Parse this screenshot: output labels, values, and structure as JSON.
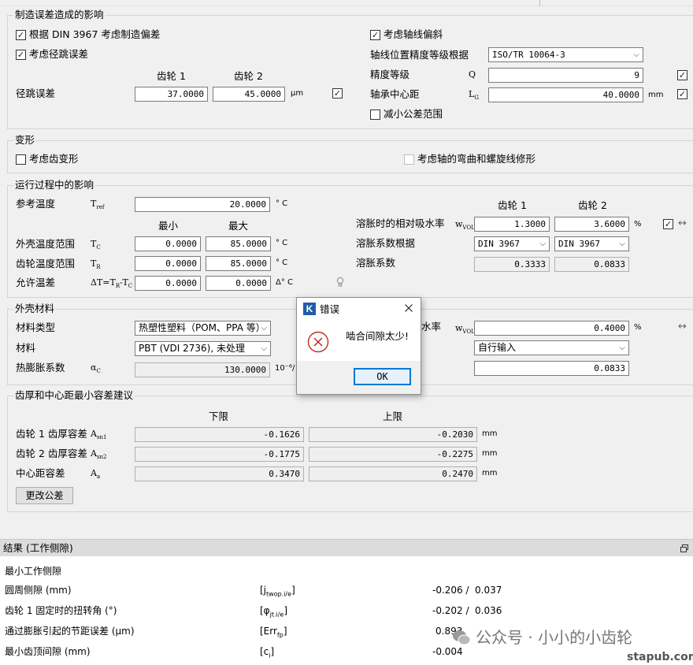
{
  "manufacturing": {
    "title": "制造误差造成的影响",
    "din3967_label": "根据 DIN 3967 考虑制造偏差",
    "runout_label": "考虑径跳误差",
    "gear1": "齿轮 1",
    "gear2": "齿轮 2",
    "runout_error_label": "径跳误差",
    "runout_g1": "37.0000",
    "runout_g2": "45.0000",
    "runout_unit": "μm",
    "axis_deviation_label": "考虑轴线偏斜",
    "axis_accuracy_label": "轴线位置精度等级根据",
    "axis_accuracy_value": "ISO/TR 10064-3",
    "accuracy_grade_label": "精度等级",
    "accuracy_grade_sym": "Q",
    "accuracy_grade_value": "9",
    "bearing_dist_label": "轴承中心距",
    "bearing_dist_sym": "L",
    "bearing_dist_sub": "G",
    "bearing_dist_value": "40.0000",
    "bearing_dist_unit": "mm",
    "reduce_tol_label": "减小公差范围"
  },
  "deformation": {
    "title": "变形",
    "tooth_label": "考虑齿变形",
    "shaft_label": "考虑轴的弯曲和螺旋线修形"
  },
  "operation": {
    "title": "运行过程中的影响",
    "ref_temp_label": "参考温度",
    "ref_temp_sym": "T",
    "ref_temp_sub": "ref",
    "ref_temp_value": "20.0000",
    "temp_unit": "° C",
    "min_label": "最小",
    "max_label": "最大",
    "housing_temp_label": "外壳温度范围",
    "housing_sym": "T",
    "housing_sub": "C",
    "housing_min": "0.0000",
    "housing_max": "85.0000",
    "gear_temp_label": "齿轮温度范围",
    "gear_sym": "T",
    "gear_sub": "R",
    "gear_min": "0.0000",
    "gear_max": "85.0000",
    "allow_diff_label": "允许温差",
    "allow_diff_sym": "ΔT=T",
    "allow_diff_sym_sub1": "R",
    "allow_diff_sym_mid": "-T",
    "allow_diff_sym_sub2": "C",
    "allow_min": "0.0000",
    "allow_max": "0.0000",
    "allow_unit": "Δ° C",
    "gear1": "齿轮 1",
    "gear2": "齿轮 2",
    "swelling_abs_label": "溶胀时的相对吸水率",
    "swelling_abs_sym": "w",
    "swelling_abs_sub": "VOL",
    "swelling_abs_g1": "1.3000",
    "swelling_abs_g2": "3.6000",
    "percent": "%",
    "swelling_coef_basis_label": "溶胀系数根据",
    "swelling_coef_basis_g1": "DIN 3967",
    "swelling_coef_basis_g2": "DIN 3967",
    "swelling_coef_label": "溶胀系数",
    "swelling_coef_g1": "0.3333",
    "swelling_coef_g2": "0.0833"
  },
  "housing": {
    "title": "外壳材料",
    "material_type_label": "材料类型",
    "material_type_value": "热塑性塑料（POM、PPA 等）",
    "material_label": "材料",
    "material_value": "PBT (VDI 2736), 未处理",
    "expansion_label": "热膨胀系数",
    "expansion_sym": "α",
    "expansion_sub": "C",
    "expansion_value": "130.0000",
    "expansion_unit": "10⁻⁶/",
    "abs_label_partial": "水率",
    "abs_sym": "w",
    "abs_sub": "VOL",
    "abs_value": "0.4000",
    "percent": "%",
    "input_mode_value": "自行输入",
    "coef_value": "0.0833"
  },
  "tolerance": {
    "title": "齿厚和中心距最小容差建议",
    "lower_label": "下限",
    "upper_label": "上限",
    "g1_label": "齿轮 1 齿厚容差",
    "g1_sym": "A",
    "g1_sub": "sn1",
    "g1_lower": "-0.1626",
    "g1_upper": "-0.2030",
    "g2_label": "齿轮 2 齿厚容差",
    "g2_sym": "A",
    "g2_sub": "sn2",
    "g2_lower": "-0.1775",
    "g2_upper": "-0.2275",
    "center_label": "中心距容差",
    "center_sym": "A",
    "center_sub": "a",
    "center_lower": "0.3470",
    "center_upper": "0.2470",
    "unit": "mm",
    "change_button": "更改公差"
  },
  "dialog": {
    "title": "错误",
    "app_icon_letter": "K",
    "message": "啮合间隙太少!",
    "ok_label": "OK"
  },
  "results": {
    "title": "结果 (工作侧隙)",
    "heading": "最小工作侧隙",
    "rows": [
      {
        "label": "圆周侧隙 (mm)",
        "sym": "[j",
        "sub": "twop.i/e",
        "close": "]",
        "v1": "-0.206 /",
        "v2": "0.037"
      },
      {
        "label": "齿轮 1 固定时的扭转角 (°)",
        "sym": "[φ",
        "sub": "jt.i/e",
        "close": "]",
        "v1": "-0.202 /",
        "v2": "0.036"
      },
      {
        "label": "通过膨胀引起的节距误差 (μm)",
        "sym": "[Err",
        "sub": "fp",
        "close": "]",
        "v1": "0.893",
        "v2": ""
      },
      {
        "label": "最小齿顶间隙 (mm)",
        "sym": "[c",
        "sub": "i",
        "close": "]",
        "v1": "-0.004",
        "v2": ""
      }
    ]
  },
  "watermark": {
    "text": "公众号 · 小小的小齿轮",
    "site": "stapub.com"
  }
}
